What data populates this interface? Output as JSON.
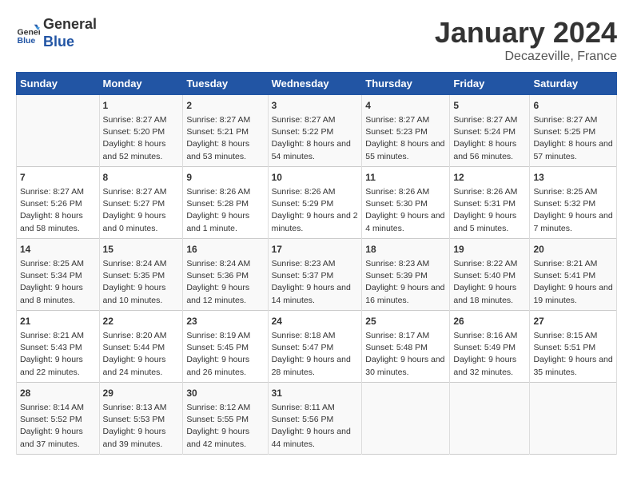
{
  "header": {
    "logo_general": "General",
    "logo_blue": "Blue",
    "month": "January 2024",
    "location": "Decazeville, France"
  },
  "days_of_week": [
    "Sunday",
    "Monday",
    "Tuesday",
    "Wednesday",
    "Thursday",
    "Friday",
    "Saturday"
  ],
  "weeks": [
    [
      {
        "day": "",
        "sunrise": "",
        "sunset": "",
        "daylight": ""
      },
      {
        "day": "1",
        "sunrise": "Sunrise: 8:27 AM",
        "sunset": "Sunset: 5:20 PM",
        "daylight": "Daylight: 8 hours and 52 minutes."
      },
      {
        "day": "2",
        "sunrise": "Sunrise: 8:27 AM",
        "sunset": "Sunset: 5:21 PM",
        "daylight": "Daylight: 8 hours and 53 minutes."
      },
      {
        "day": "3",
        "sunrise": "Sunrise: 8:27 AM",
        "sunset": "Sunset: 5:22 PM",
        "daylight": "Daylight: 8 hours and 54 minutes."
      },
      {
        "day": "4",
        "sunrise": "Sunrise: 8:27 AM",
        "sunset": "Sunset: 5:23 PM",
        "daylight": "Daylight: 8 hours and 55 minutes."
      },
      {
        "day": "5",
        "sunrise": "Sunrise: 8:27 AM",
        "sunset": "Sunset: 5:24 PM",
        "daylight": "Daylight: 8 hours and 56 minutes."
      },
      {
        "day": "6",
        "sunrise": "Sunrise: 8:27 AM",
        "sunset": "Sunset: 5:25 PM",
        "daylight": "Daylight: 8 hours and 57 minutes."
      }
    ],
    [
      {
        "day": "7",
        "sunrise": "Sunrise: 8:27 AM",
        "sunset": "Sunset: 5:26 PM",
        "daylight": "Daylight: 8 hours and 58 minutes."
      },
      {
        "day": "8",
        "sunrise": "Sunrise: 8:27 AM",
        "sunset": "Sunset: 5:27 PM",
        "daylight": "Daylight: 9 hours and 0 minutes."
      },
      {
        "day": "9",
        "sunrise": "Sunrise: 8:26 AM",
        "sunset": "Sunset: 5:28 PM",
        "daylight": "Daylight: 9 hours and 1 minute."
      },
      {
        "day": "10",
        "sunrise": "Sunrise: 8:26 AM",
        "sunset": "Sunset: 5:29 PM",
        "daylight": "Daylight: 9 hours and 2 minutes."
      },
      {
        "day": "11",
        "sunrise": "Sunrise: 8:26 AM",
        "sunset": "Sunset: 5:30 PM",
        "daylight": "Daylight: 9 hours and 4 minutes."
      },
      {
        "day": "12",
        "sunrise": "Sunrise: 8:26 AM",
        "sunset": "Sunset: 5:31 PM",
        "daylight": "Daylight: 9 hours and 5 minutes."
      },
      {
        "day": "13",
        "sunrise": "Sunrise: 8:25 AM",
        "sunset": "Sunset: 5:32 PM",
        "daylight": "Daylight: 9 hours and 7 minutes."
      }
    ],
    [
      {
        "day": "14",
        "sunrise": "Sunrise: 8:25 AM",
        "sunset": "Sunset: 5:34 PM",
        "daylight": "Daylight: 9 hours and 8 minutes."
      },
      {
        "day": "15",
        "sunrise": "Sunrise: 8:24 AM",
        "sunset": "Sunset: 5:35 PM",
        "daylight": "Daylight: 9 hours and 10 minutes."
      },
      {
        "day": "16",
        "sunrise": "Sunrise: 8:24 AM",
        "sunset": "Sunset: 5:36 PM",
        "daylight": "Daylight: 9 hours and 12 minutes."
      },
      {
        "day": "17",
        "sunrise": "Sunrise: 8:23 AM",
        "sunset": "Sunset: 5:37 PM",
        "daylight": "Daylight: 9 hours and 14 minutes."
      },
      {
        "day": "18",
        "sunrise": "Sunrise: 8:23 AM",
        "sunset": "Sunset: 5:39 PM",
        "daylight": "Daylight: 9 hours and 16 minutes."
      },
      {
        "day": "19",
        "sunrise": "Sunrise: 8:22 AM",
        "sunset": "Sunset: 5:40 PM",
        "daylight": "Daylight: 9 hours and 18 minutes."
      },
      {
        "day": "20",
        "sunrise": "Sunrise: 8:21 AM",
        "sunset": "Sunset: 5:41 PM",
        "daylight": "Daylight: 9 hours and 19 minutes."
      }
    ],
    [
      {
        "day": "21",
        "sunrise": "Sunrise: 8:21 AM",
        "sunset": "Sunset: 5:43 PM",
        "daylight": "Daylight: 9 hours and 22 minutes."
      },
      {
        "day": "22",
        "sunrise": "Sunrise: 8:20 AM",
        "sunset": "Sunset: 5:44 PM",
        "daylight": "Daylight: 9 hours and 24 minutes."
      },
      {
        "day": "23",
        "sunrise": "Sunrise: 8:19 AM",
        "sunset": "Sunset: 5:45 PM",
        "daylight": "Daylight: 9 hours and 26 minutes."
      },
      {
        "day": "24",
        "sunrise": "Sunrise: 8:18 AM",
        "sunset": "Sunset: 5:47 PM",
        "daylight": "Daylight: 9 hours and 28 minutes."
      },
      {
        "day": "25",
        "sunrise": "Sunrise: 8:17 AM",
        "sunset": "Sunset: 5:48 PM",
        "daylight": "Daylight: 9 hours and 30 minutes."
      },
      {
        "day": "26",
        "sunrise": "Sunrise: 8:16 AM",
        "sunset": "Sunset: 5:49 PM",
        "daylight": "Daylight: 9 hours and 32 minutes."
      },
      {
        "day": "27",
        "sunrise": "Sunrise: 8:15 AM",
        "sunset": "Sunset: 5:51 PM",
        "daylight": "Daylight: 9 hours and 35 minutes."
      }
    ],
    [
      {
        "day": "28",
        "sunrise": "Sunrise: 8:14 AM",
        "sunset": "Sunset: 5:52 PM",
        "daylight": "Daylight: 9 hours and 37 minutes."
      },
      {
        "day": "29",
        "sunrise": "Sunrise: 8:13 AM",
        "sunset": "Sunset: 5:53 PM",
        "daylight": "Daylight: 9 hours and 39 minutes."
      },
      {
        "day": "30",
        "sunrise": "Sunrise: 8:12 AM",
        "sunset": "Sunset: 5:55 PM",
        "daylight": "Daylight: 9 hours and 42 minutes."
      },
      {
        "day": "31",
        "sunrise": "Sunrise: 8:11 AM",
        "sunset": "Sunset: 5:56 PM",
        "daylight": "Daylight: 9 hours and 44 minutes."
      },
      {
        "day": "",
        "sunrise": "",
        "sunset": "",
        "daylight": ""
      },
      {
        "day": "",
        "sunrise": "",
        "sunset": "",
        "daylight": ""
      },
      {
        "day": "",
        "sunrise": "",
        "sunset": "",
        "daylight": ""
      }
    ]
  ]
}
